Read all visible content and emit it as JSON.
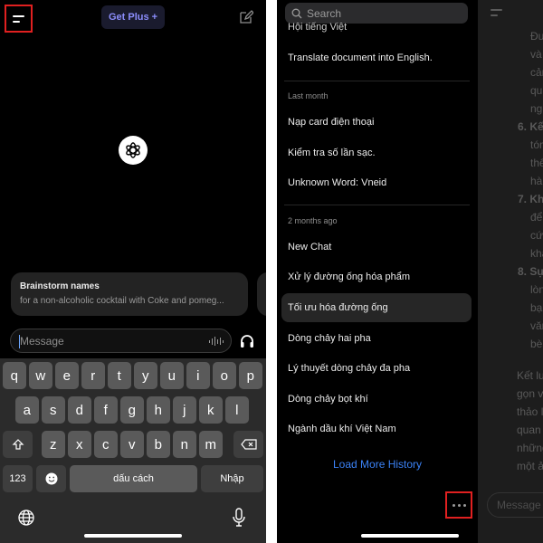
{
  "left": {
    "header": {
      "get_plus": "Get Plus",
      "get_plus_icon": "+"
    },
    "suggestion": {
      "title": "Brainstorm names",
      "subtitle": "for a non-alcoholic cocktail with Coke and pomeg..."
    },
    "composer": {
      "placeholder": "Message"
    },
    "keyboard": {
      "row1": [
        "q",
        "w",
        "e",
        "r",
        "t",
        "y",
        "u",
        "i",
        "o",
        "p"
      ],
      "row2": [
        "a",
        "s",
        "d",
        "f",
        "g",
        "h",
        "j",
        "k",
        "l"
      ],
      "row3": [
        "z",
        "x",
        "c",
        "v",
        "b",
        "n",
        "m"
      ],
      "num_label": "123",
      "space_label": "dấu cách",
      "return_label": "Nhập"
    }
  },
  "right": {
    "search": {
      "placeholder": "Search"
    },
    "history_partial": "Hội tiếng Việt",
    "history_top": "Translate document into English.",
    "section_last_month": "Last month",
    "last_month": [
      "Nạp card điện thoại",
      "Kiểm tra số lần sạc.",
      "Unknown Word: Vneid"
    ],
    "section_two_months": "2 months ago",
    "two_months": [
      "New Chat",
      "Xử lý đường ống hóa phẩm",
      "Tối ưu hóa đường ống",
      "Dòng chảy hai pha",
      "Lý thuyết dòng chảy đa pha",
      "Dòng chảy bọt khí",
      "Ngành dầu khí Việt Nam"
    ],
    "load_more": "Load More History",
    "overlay": {
      "lines": [
        "Đưa",
        "và g",
        "cản",
        "qua",
        "ngà",
        "6. Kết",
        "tóm",
        "thể",
        "hài l",
        "7. Khu",
        "để x",
        "cứu",
        "khá",
        "8. Sự (",
        "lòng",
        "bạn",
        "văn,",
        "bè, c",
        "Kết luậ",
        "gọn và",
        "thảo lu",
        "quan tr",
        "những",
        "một ản"
      ],
      "message_placeholder": "Message"
    }
  },
  "colors": {
    "highlight": "#e02020",
    "accent": "#3b82f6",
    "plus": "#8b8dfb"
  }
}
